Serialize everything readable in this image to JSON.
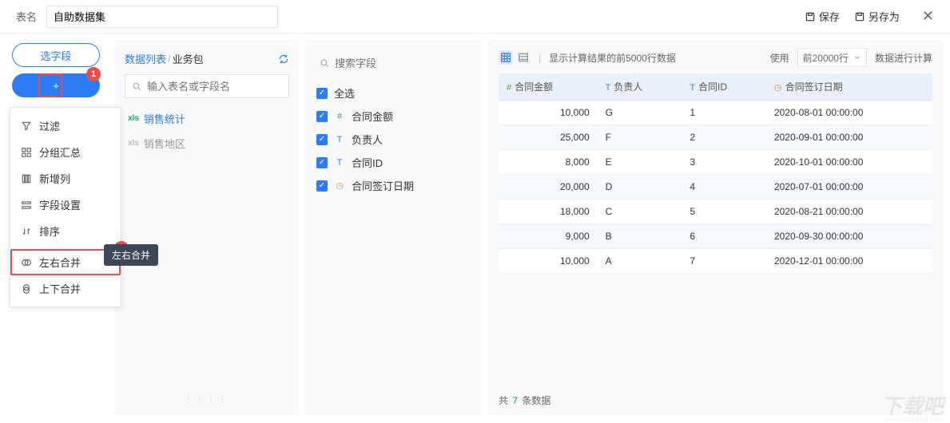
{
  "header": {
    "label": "表名",
    "value": "自助数据集",
    "save": "保存",
    "save_as": "另存为"
  },
  "left": {
    "select_fields": "选字段",
    "add": "+",
    "callout1": "1",
    "callout2": "2",
    "menu": {
      "filter": "过滤",
      "group": "分组汇总",
      "newcol": "新增列",
      "fieldset": "字段设置",
      "sort": "排序",
      "hjoin": "左右合并",
      "vjoin": "上下合并"
    },
    "tooltip": "左右合并"
  },
  "mid": {
    "tab1": "数据列表",
    "tab2": "业务包",
    "placeholder": "输入表名或字段名",
    "tables": {
      "t1": "销售统计",
      "t2": "销售地区"
    }
  },
  "fields": {
    "placeholder": "搜索字段",
    "all": "全选",
    "f1": "合同金额",
    "f2": "负责人",
    "f3": "合同ID",
    "f4": "合同签订日期"
  },
  "right": {
    "hint": "显示计算结果的前5000行数据",
    "use_label": "使用",
    "rows_value": "前20000行",
    "calc": "数据进行计算",
    "cols": {
      "c1": "合同金额",
      "c2": "负责人",
      "c3": "合同ID",
      "c4": "合同签订日期"
    },
    "data": [
      {
        "amt": "10,000",
        "p": "G",
        "id": "1",
        "d": "2020-08-01 00:00:00"
      },
      {
        "amt": "25,000",
        "p": "F",
        "id": "2",
        "d": "2020-09-01 00:00:00"
      },
      {
        "amt": "8,000",
        "p": "E",
        "id": "3",
        "d": "2020-10-01 00:00:00"
      },
      {
        "amt": "20,000",
        "p": "D",
        "id": "4",
        "d": "2020-07-01 00:00:00"
      },
      {
        "amt": "18,000",
        "p": "C",
        "id": "5",
        "d": "2020-08-21 00:00:00"
      },
      {
        "amt": "9,000",
        "p": "B",
        "id": "6",
        "d": "2020-09-30 00:00:00"
      },
      {
        "amt": "10,000",
        "p": "A",
        "id": "7",
        "d": "2020-12-01 00:00:00"
      }
    ],
    "footer_prefix": "共",
    "footer_count": "7",
    "footer_suffix": "条数据"
  },
  "watermark": {
    "main": "下载吧",
    "sub": "www.xiazaiba.com"
  }
}
